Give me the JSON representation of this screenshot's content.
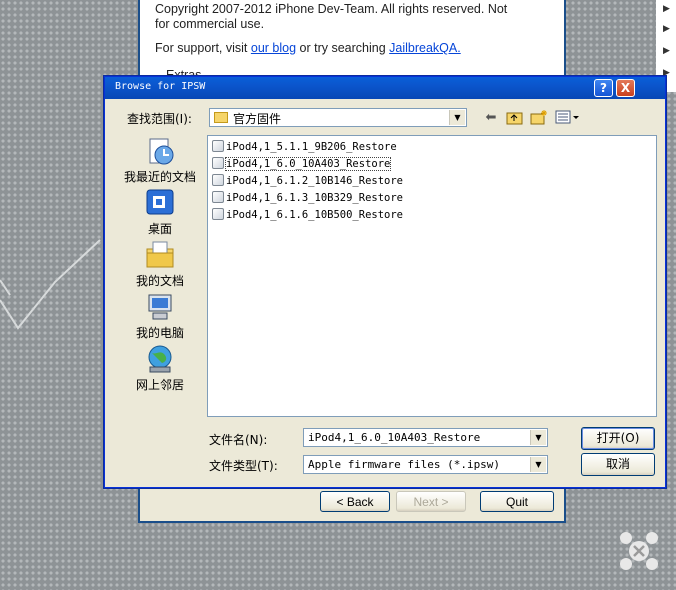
{
  "back_window": {
    "copyright": "Copyright 2007-2012 iPhone Dev-Team. All rights reserved. Not for commercial use.",
    "copyright_line1": "Copyright 2007-2012 iPhone Dev-Team. All rights reserved. Not",
    "copyright_line2": "for commercial use.",
    "support_prefix": "For support, visit ",
    "blog_link": "our blog",
    "support_mid": " or try searching ",
    "jailbreak_link": "JailbreakQA.",
    "extras_label": "Extras",
    "back_button": "< Back",
    "next_button": "Next >",
    "quit_button": "Quit"
  },
  "dialog": {
    "title": "Browse for IPSW",
    "help_button": "?",
    "close_button": "X",
    "look_in_label": "查找范围(I):",
    "look_in_value": "官方固件",
    "toolbar": {
      "back_icon": "back-arrow-icon",
      "up_icon": "up-folder-icon",
      "new_folder_icon": "new-folder-icon",
      "view_icon": "view-menu-icon"
    },
    "places": [
      {
        "label": "我最近的文档",
        "icon": "recent-documents-icon"
      },
      {
        "label": "桌面",
        "icon": "desktop-icon"
      },
      {
        "label": "我的文档",
        "icon": "my-documents-icon"
      },
      {
        "label": "我的电脑",
        "icon": "my-computer-icon"
      },
      {
        "label": "网上邻居",
        "icon": "network-places-icon"
      }
    ],
    "files": [
      {
        "name": "iPod4,1_5.1.1_9B206_Restore"
      },
      {
        "name": "iPod4,1_6.0_10A403_Restore"
      },
      {
        "name": "iPod4,1_6.1.2_10B146_Restore"
      },
      {
        "name": "iPod4,1_6.1.3_10B329_Restore"
      },
      {
        "name": "iPod4,1_6.1.6_10B500_Restore"
      }
    ],
    "selected_index": 1,
    "filename_label": "文件名(N):",
    "filename_value": "iPod4,1_6.0_10A403_Restore",
    "filetype_label": "文件类型(T):",
    "filetype_value": "Apple firmware files (*.ipsw)",
    "open_button": "打开(O)",
    "cancel_button": "取消"
  },
  "colors": {
    "title_bar": "#0b55cc",
    "dialog_bg": "#ece9d8",
    "link": "#0645d8"
  }
}
